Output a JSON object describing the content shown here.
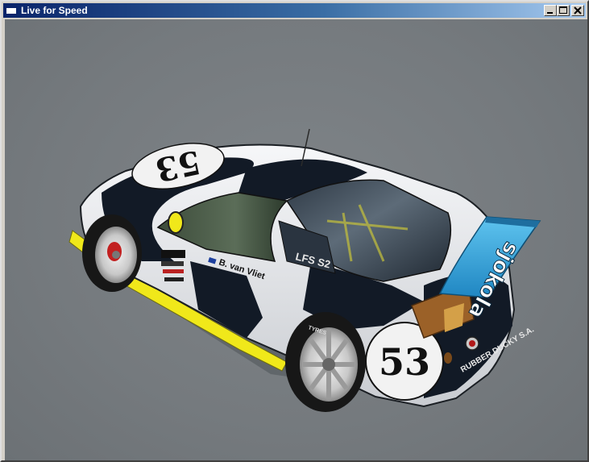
{
  "window": {
    "title": "Live for Speed",
    "controls": [
      {
        "name": "minimize-button",
        "icon": "minimize-icon"
      },
      {
        "name": "maximize-button",
        "icon": "maximize-icon"
      },
      {
        "name": "close-button",
        "icon": "close-icon"
      }
    ]
  },
  "car": {
    "race_number": "53",
    "roof_number": "53",
    "model_label": "LFS S2",
    "driver_name": "B. van Vliet",
    "wing_sponsor": "sjokola",
    "bumper_text": "RUBBER DUCKY S.A.",
    "tyre_brand": "TYRES"
  },
  "colors": {
    "titlebar_start": "#0a246a",
    "titlebar_end": "#a6caf0",
    "viewport_bg": "#777c80",
    "car_white": "#eef0f2",
    "car_black": "#121a26",
    "wing_blue": "#31a8e0",
    "stripe_yellow": "#f0e81a"
  }
}
